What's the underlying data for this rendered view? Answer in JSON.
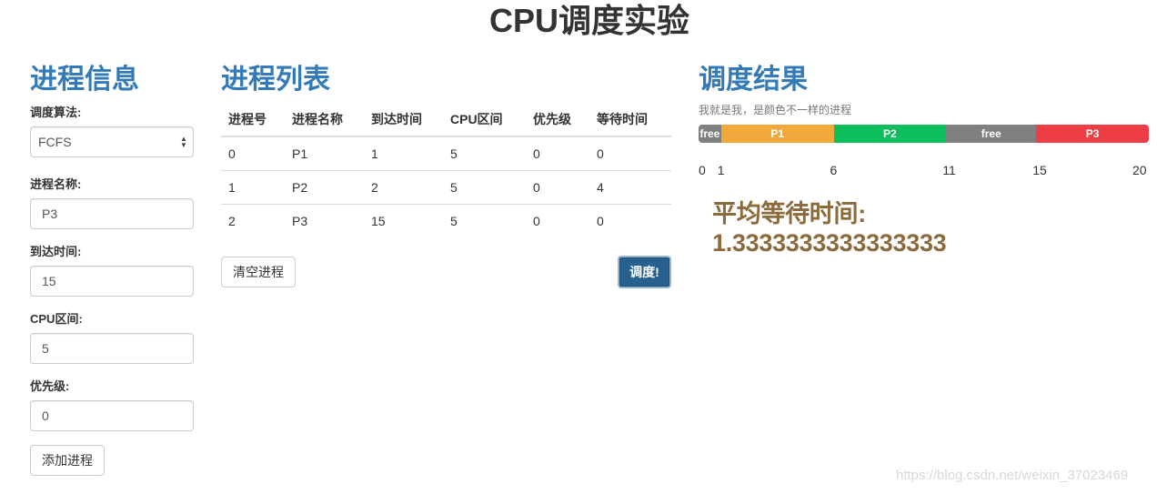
{
  "page_title": "CPU调度实验",
  "process_info": {
    "title": "进程信息",
    "algorithm_label": "调度算法:",
    "algorithm_value": "FCFS",
    "name_label": "进程名称:",
    "name_value": "P3",
    "arrival_label": "到达时间:",
    "arrival_value": "15",
    "burst_label": "CPU区间:",
    "burst_value": "5",
    "priority_label": "优先级:",
    "priority_value": "0",
    "add_button": "添加进程"
  },
  "process_list": {
    "title": "进程列表",
    "columns": [
      "进程号",
      "进程名称",
      "到达时间",
      "CPU区间",
      "优先级",
      "等待时间"
    ],
    "rows": [
      [
        "0",
        "P1",
        "1",
        "5",
        "0",
        "0"
      ],
      [
        "1",
        "P2",
        "2",
        "5",
        "0",
        "4"
      ],
      [
        "2",
        "P3",
        "15",
        "5",
        "0",
        "0"
      ]
    ],
    "clear_button": "清空进程",
    "schedule_button": "调度!"
  },
  "schedule_result": {
    "title": "调度结果",
    "subtitle": "我就是我，是颜色不一样的进程",
    "segments": [
      {
        "label": "free",
        "start": 0,
        "end": 1,
        "color": "#808080"
      },
      {
        "label": "P1",
        "start": 1,
        "end": 6,
        "color": "#f0a93a"
      },
      {
        "label": "P2",
        "start": 6,
        "end": 11,
        "color": "#0dbe5d"
      },
      {
        "label": "free",
        "start": 11,
        "end": 15,
        "color": "#808080"
      },
      {
        "label": "P3",
        "start": 15,
        "end": 20,
        "color": "#ec3e44"
      }
    ],
    "ticks": [
      "0",
      "1",
      "6",
      "11",
      "15",
      "20"
    ],
    "avg_wait_label": "平均等待时间:",
    "avg_wait_value": "1.3333333333333333"
  },
  "watermark": "https://blog.csdn.net/weixin_37023469"
}
